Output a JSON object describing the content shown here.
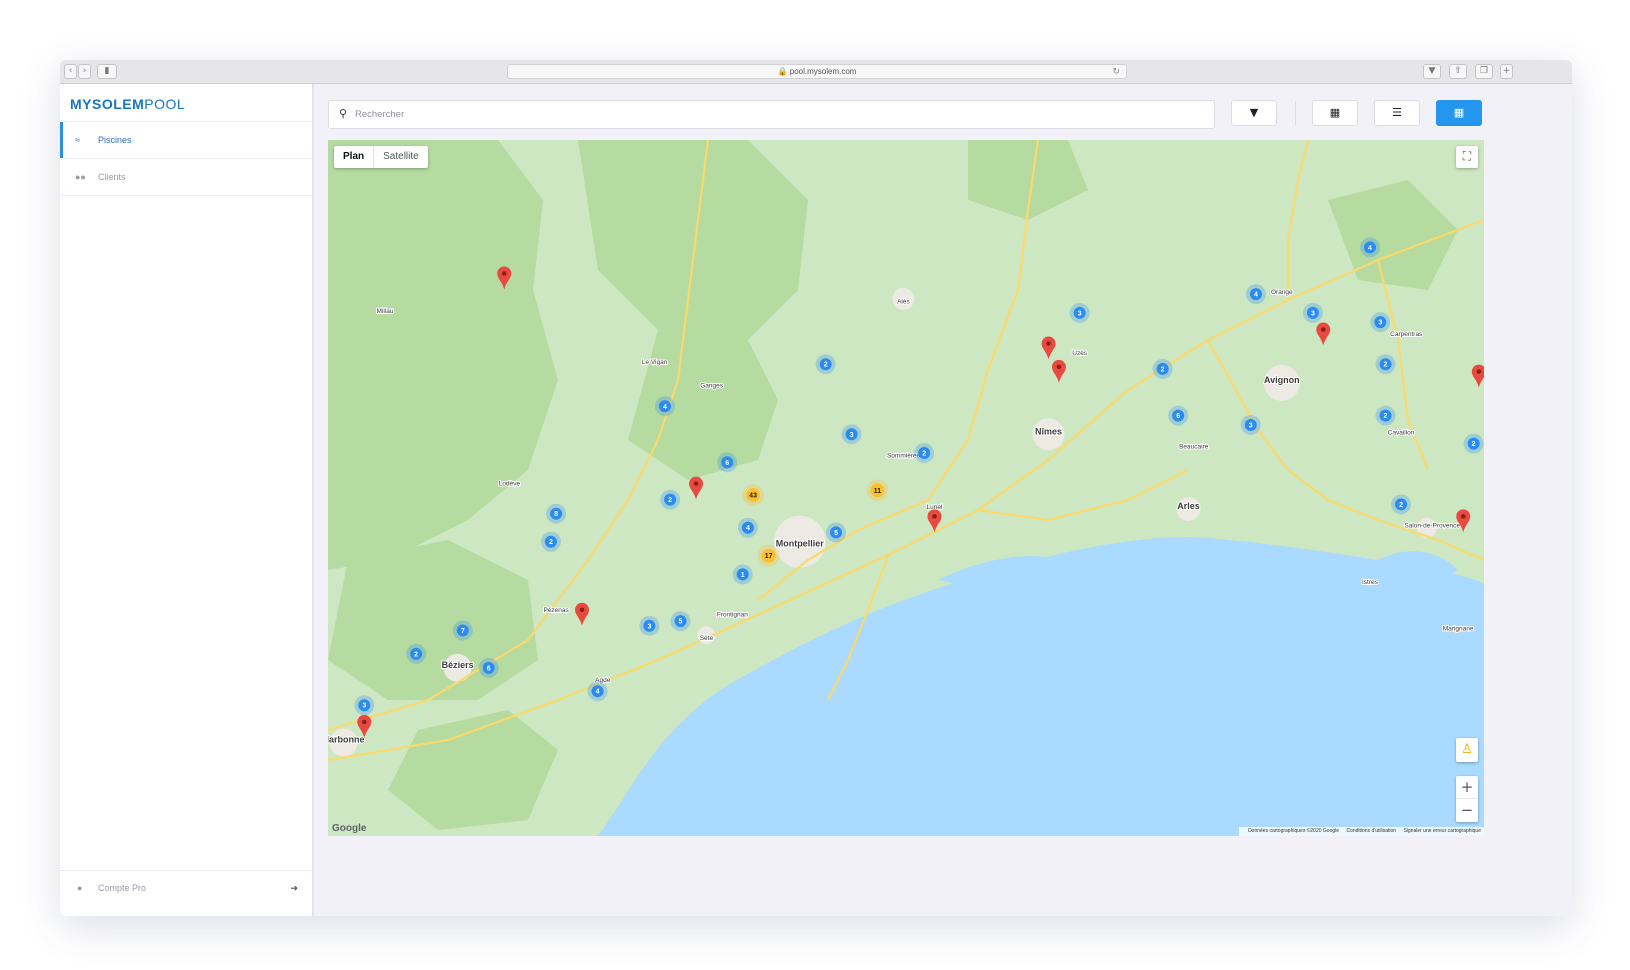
{
  "browser": {
    "url": "pool.mysolem.com"
  },
  "brand": {
    "name_bold": "MYSOLEM",
    "name_light": "POOL"
  },
  "sidebar": {
    "items": [
      {
        "label": "Piscines",
        "active": true
      },
      {
        "label": "Clients",
        "active": false
      }
    ],
    "footer_label": "Compte Pro"
  },
  "toolbar": {
    "search_placeholder": "Rechercher",
    "active_view": "map"
  },
  "map": {
    "type_buttons": [
      "Plan",
      "Satellite"
    ],
    "logo_text": "Google",
    "attribution": [
      "Données cartographiques ©2020 Google",
      "Conditions d'utilisation",
      "Signaler une erreur cartographique"
    ],
    "colors": {
      "land": "#cde7c2",
      "forest": "#b5dba1",
      "urban": "#eceae3",
      "water": "#aadaff",
      "road": "#fbd96b",
      "cluster_small": "#2a8bf2",
      "cluster_large": "#fbc02d",
      "pin": "#e84a3f"
    },
    "place_labels": [
      "Montpellier",
      "Nîmes",
      "Avignon",
      "Arles",
      "Béziers",
      "Narbonne",
      "Sète",
      "Lunel",
      "Alès",
      "Agde",
      "Carpentras",
      "Cavaillon",
      "Salon-de-Provence",
      "Orange",
      "Uzès",
      "Lodève",
      "Pézenas",
      "Frontignan",
      "Marignane",
      "Istres",
      "Millau",
      "Le Vigan",
      "Ganges",
      "Sommières",
      "Beaucaire"
    ],
    "clusters": [
      {
        "count": "43",
        "lng": 3.79,
        "lat": 43.71
      },
      {
        "count": "17",
        "lng": 3.82,
        "lat": 43.58
      },
      {
        "count": "11",
        "lng": 4.03,
        "lat": 43.72
      },
      {
        "count": "2",
        "lng": 3.93,
        "lat": 43.99
      },
      {
        "count": "4",
        "lng": 3.62,
        "lat": 43.9
      },
      {
        "count": "3",
        "lng": 3.98,
        "lat": 43.84
      },
      {
        "count": "6",
        "lng": 3.74,
        "lat": 43.78
      },
      {
        "count": "2",
        "lng": 3.63,
        "lat": 43.7
      },
      {
        "count": "4",
        "lng": 3.78,
        "lat": 43.64
      },
      {
        "count": "5",
        "lng": 3.95,
        "lat": 43.63
      },
      {
        "count": "2",
        "lng": 4.12,
        "lat": 43.8
      },
      {
        "count": "1",
        "lng": 3.77,
        "lat": 43.54
      },
      {
        "count": "8",
        "lng": 3.41,
        "lat": 43.67
      },
      {
        "count": "2",
        "lng": 3.4,
        "lat": 43.61
      },
      {
        "count": "3",
        "lng": 3.59,
        "lat": 43.43
      },
      {
        "count": "5",
        "lng": 3.65,
        "lat": 43.44
      },
      {
        "count": "7",
        "lng": 3.23,
        "lat": 43.42
      },
      {
        "count": "2",
        "lng": 3.14,
        "lat": 43.37
      },
      {
        "count": "6",
        "lng": 3.28,
        "lat": 43.34
      },
      {
        "count": "4",
        "lng": 3.49,
        "lat": 43.29
      },
      {
        "count": "3",
        "lng": 3.04,
        "lat": 43.26
      },
      {
        "count": "3",
        "lng": 4.42,
        "lat": 44.1
      },
      {
        "count": "2",
        "lng": 4.58,
        "lat": 43.98
      },
      {
        "count": "6",
        "lng": 4.61,
        "lat": 43.88
      },
      {
        "count": "3",
        "lng": 4.75,
        "lat": 43.86
      },
      {
        "count": "4",
        "lng": 4.76,
        "lat": 44.14
      },
      {
        "count": "3",
        "lng": 4.87,
        "lat": 44.1
      },
      {
        "count": "3",
        "lng": 5.0,
        "lat": 44.08
      },
      {
        "count": "2",
        "lng": 5.01,
        "lat": 43.99
      },
      {
        "count": "2",
        "lng": 5.01,
        "lat": 43.88
      },
      {
        "count": "4",
        "lng": 4.98,
        "lat": 44.24
      },
      {
        "count": "2",
        "lng": 5.04,
        "lat": 43.69
      },
      {
        "count": "2",
        "lng": 5.18,
        "lat": 43.82
      }
    ],
    "pins": [
      {
        "lng": 3.31,
        "lat": 44.15
      },
      {
        "lng": 3.68,
        "lat": 43.7
      },
      {
        "lng": 3.46,
        "lat": 43.43
      },
      {
        "lng": 3.04,
        "lat": 43.19
      },
      {
        "lng": 4.14,
        "lat": 43.63
      },
      {
        "lng": 4.36,
        "lat": 44.0
      },
      {
        "lng": 4.38,
        "lat": 43.95
      },
      {
        "lng": 4.89,
        "lat": 44.03
      },
      {
        "lng": 5.19,
        "lat": 43.94
      },
      {
        "lng": 5.16,
        "lat": 43.63
      }
    ]
  }
}
